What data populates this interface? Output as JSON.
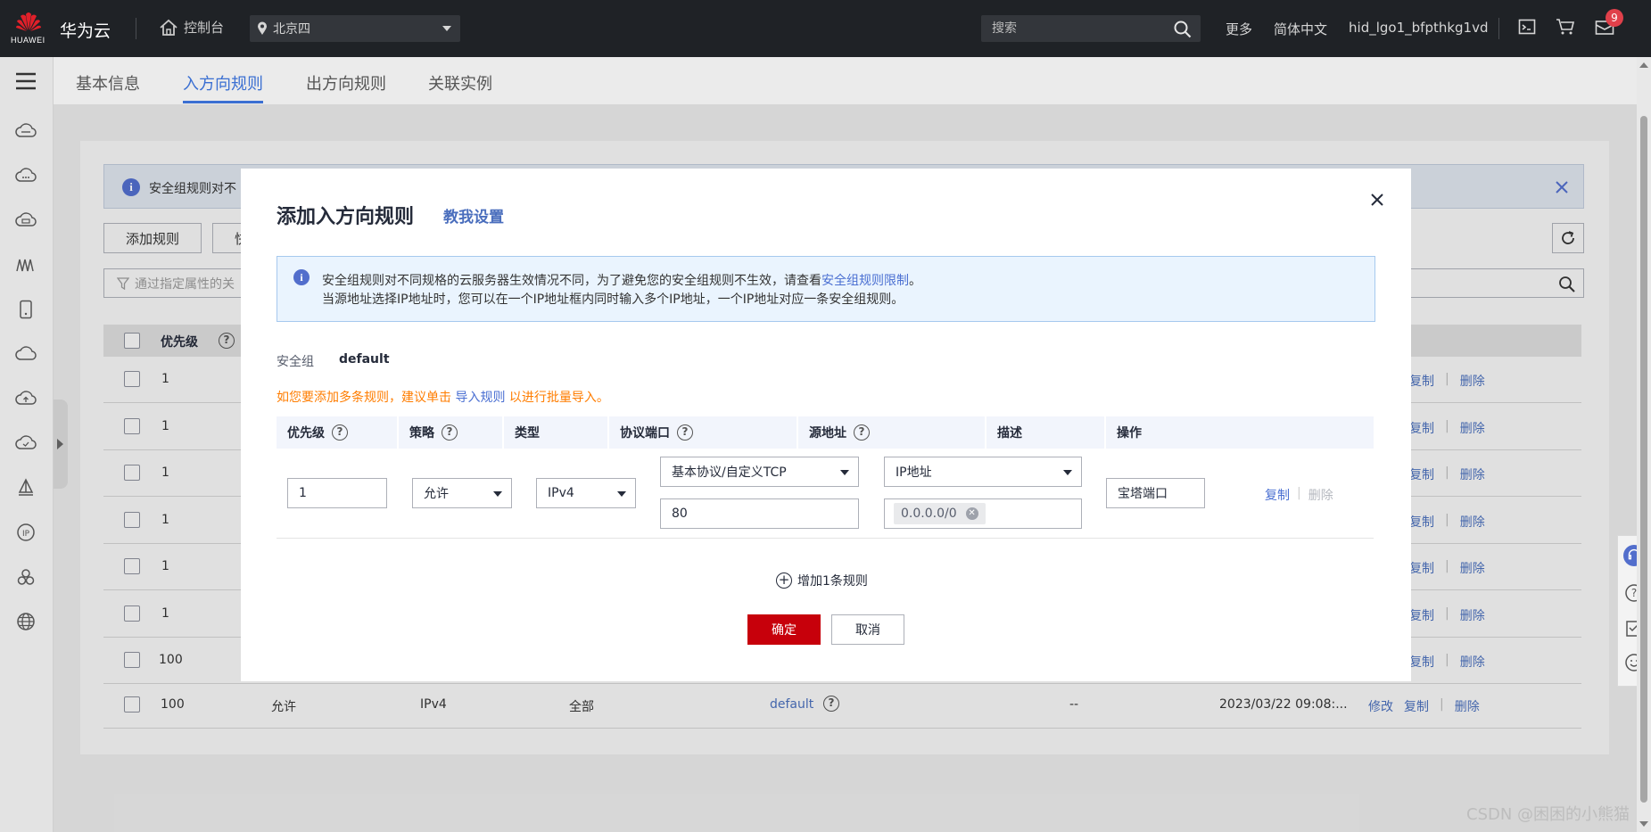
{
  "topbar": {
    "logo_text": "HUAWEI",
    "brand": "华为云",
    "console": "控制台",
    "region": "北京四",
    "search_placeholder": "搜索",
    "links": [
      "更多",
      "简体中文",
      "hid_lgo1_bfpthkg1vd"
    ],
    "notifications": "9"
  },
  "tabs": [
    "基本信息",
    "入方向规则",
    "出方向规则",
    "关联实例"
  ],
  "background": {
    "notice": "安全组规则对不",
    "add_rule_button": "添加规则",
    "second_button": "快",
    "filter_placeholder": "通过指定属性的关",
    "header_priority": "优先级",
    "rows": [
      {
        "priority": "1",
        "links": [
          "复制",
          "删除"
        ]
      },
      {
        "priority": "1",
        "links": [
          "复制",
          "删除"
        ]
      },
      {
        "priority": "1",
        "links": [
          "复制",
          "删除"
        ]
      },
      {
        "priority": "1",
        "links": [
          "复制",
          "删除"
        ]
      },
      {
        "priority": "1",
        "links": [
          "复制",
          "删除"
        ]
      },
      {
        "priority": "1",
        "links": [
          "复制",
          "删除"
        ]
      },
      {
        "priority": "100",
        "links": [
          "复制",
          "删除"
        ]
      }
    ],
    "last_row": {
      "priority": "100",
      "policy": "允许",
      "type": "IPv4",
      "port": "全部",
      "source": "default",
      "desc": "--",
      "time": "2023/03/22 09:08:...",
      "links": [
        "修改",
        "复制",
        "删除"
      ]
    }
  },
  "modal": {
    "title": "添加入方向规则",
    "guide": "教我设置",
    "info_line1_a": "安全组规则对不同规格的云服务器生效情况不同，为了避免您的安全组规则不生效，请查看",
    "info_line1_link": "安全组规则限制",
    "info_line1_b": "。",
    "info_line2": "当源地址选择IP地址时，您可以在一个IP地址框内同时输入多个IP地址，一个IP地址对应一条安全组规则。",
    "sg_label": "安全组",
    "sg_value": "default",
    "tip_a": "如您要添加多条规则，建议单击",
    "tip_link": "导入规则",
    "tip_b": "以进行批量导入。",
    "columns": [
      "优先级",
      "策略",
      "类型",
      "协议端口",
      "源地址",
      "描述",
      "操作"
    ],
    "row": {
      "priority": "1",
      "policy": "允许",
      "type": "IPv4",
      "protocol": "基本协议/自定义TCP",
      "port": "80",
      "source_type": "IP地址",
      "source_ip": "0.0.0.0/0",
      "description": "宝塔端口",
      "copy": "复制",
      "delete": "删除"
    },
    "add_rule": "增加1条规则",
    "ok": "确定",
    "cancel": "取消"
  },
  "watermark": "CSDN @困困的小熊猫"
}
